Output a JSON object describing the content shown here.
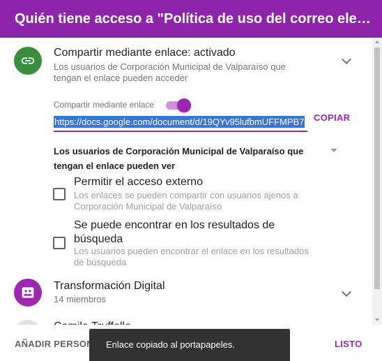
{
  "header": {
    "title": "Quién tiene acceso a \"Política de uso del correo electrónico\""
  },
  "link_share": {
    "title": "Compartir mediante enlace: activado",
    "description": "Los usuarios de Corporación Municipal de Valparaíso que tengan el enlace pueden acceder",
    "toggle_label": "Compartir mediante enlace",
    "toggle_on": true,
    "url": "https://docs.google.com/document/d/19QYv95lufbmUFFMPB7",
    "copy_label": "COPIAR",
    "audience_select": "Los usuarios de Corporación Municipal de Valparaíso que tengan el enlace pueden ver",
    "options": [
      {
        "title": "Permitir el acceso externo",
        "description": "Los enlaces se pueden compartir con usuarios ajenos a Corporación Municipal de Valparaíso",
        "checked": false
      },
      {
        "title": "Se puede encontrar en los resultados de búsqueda",
        "description": "Los usuarios pueden encontrar el enlace en los resultados de búsqueda",
        "checked": false
      }
    ]
  },
  "groups": [
    {
      "name": "Transformación Digital",
      "members": "14 miembros"
    }
  ],
  "people": [
    {
      "name": "Camila Truffello"
    }
  ],
  "footer": {
    "add_label": "AÑADIR PERSONAS",
    "done_label": "LISTO"
  },
  "snackbar": {
    "message": "Enlace copiado al portapapeles."
  },
  "colors": {
    "header": "#8e24aa",
    "accent": "#9c27b0",
    "link_avatar": "#388e3c",
    "selection": "#3875d7"
  }
}
